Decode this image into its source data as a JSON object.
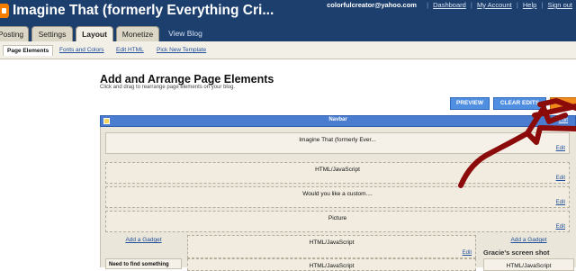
{
  "header": {
    "blog_title": "Imagine That (formerly Everything Cri...",
    "email": "colorfulcreator@yahoo.com",
    "links": [
      "Dashboard",
      "My Account",
      "Help",
      "Sign out"
    ]
  },
  "tabs": [
    "Posting",
    "Settings",
    "Layout",
    "Monetize",
    "View Blog"
  ],
  "subtabs": [
    "Page Elements",
    "Fonts and Colors",
    "Edit HTML",
    "Pick New Template"
  ],
  "page": {
    "title": "Add and Arrange Page Elements",
    "subtitle": "Click and drag to rearrange page elements on your blog."
  },
  "buttons": {
    "preview": "PREVIEW",
    "clear_edits": "CLEAR EDITS"
  },
  "navbar": {
    "label": "Navbar",
    "edit": "Edit"
  },
  "widgets": {
    "header": "Imagine That (formerly Ever...",
    "html1": "HTML/JavaScript",
    "custom": "Would you like a custom....",
    "picture": "Picture",
    "html_main1": "HTML/JavaScript",
    "html_main2": "HTML/JavaScript",
    "html_right": "HTML/JavaScript",
    "left_box": "Need to find something"
  },
  "edit_label": "Edit",
  "add_gadget": "Add a Gadget",
  "caption": "Gracie's screen shot",
  "colors": {
    "header_bg": "#1c3f6e",
    "accent_blue": "#4f8ee0",
    "scribble": "#8b0a0a"
  }
}
